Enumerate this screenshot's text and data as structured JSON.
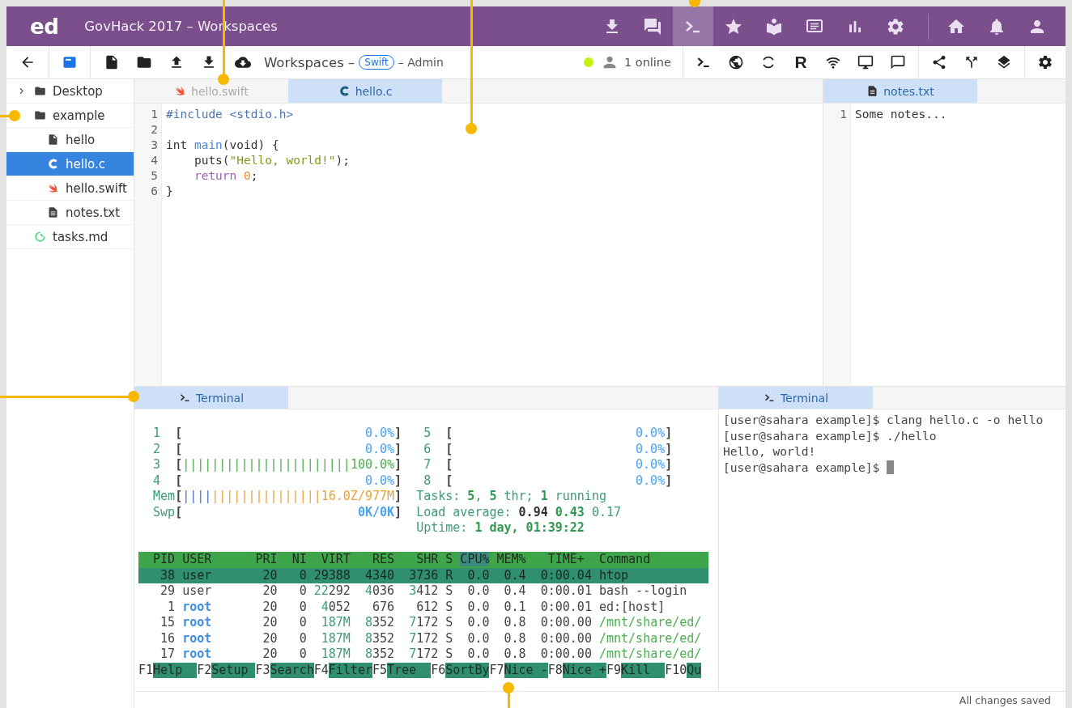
{
  "app_bar": {
    "logo": "ed",
    "title": "GovHack 2017 – Workspaces",
    "buttons": [
      {
        "kind": "download",
        "selected": false
      },
      {
        "kind": "chat",
        "selected": false
      },
      {
        "kind": "terminal",
        "selected": true
      },
      {
        "kind": "star",
        "selected": false
      },
      {
        "kind": "reader",
        "selected": false
      },
      {
        "kind": "slides",
        "selected": false
      },
      {
        "kind": "chart",
        "selected": false
      },
      {
        "kind": "settings",
        "selected": false
      }
    ],
    "user_buttons": [
      {
        "kind": "home",
        "selected": false
      },
      {
        "kind": "notifications",
        "selected": false
      },
      {
        "kind": "account",
        "selected": false
      }
    ]
  },
  "toolbar": {
    "title": "Workspaces –",
    "badge": "Swift",
    "role": "– Admin",
    "presence": "1 online",
    "r_button": "R"
  },
  "file_tree": [
    {
      "name": "Desktop",
      "kind": "folder",
      "expanded": false,
      "selected": false
    },
    {
      "name": "example",
      "kind": "folder",
      "expanded": true,
      "selected": false,
      "children": [
        {
          "name": "hello",
          "kind": "file",
          "selected": false
        },
        {
          "name": "hello.c",
          "kind": "c",
          "selected": true
        },
        {
          "name": "hello.swift",
          "kind": "swift",
          "selected": false
        },
        {
          "name": "notes.txt",
          "kind": "text",
          "selected": false
        }
      ]
    },
    {
      "name": "tasks.md",
      "kind": "markdown",
      "selected": false
    }
  ],
  "editor": {
    "tabs": [
      {
        "label": "hello.swift",
        "kind": "swift",
        "selected": false
      },
      {
        "label": "hello.c",
        "kind": "c",
        "selected": true
      }
    ],
    "lines": [
      {
        "number": "1",
        "tokens": [
          {
            "text": "#include <stdio.h>",
            "kind": "preprocessor"
          }
        ]
      },
      {
        "number": "2"
      },
      {
        "number": "3",
        "tokens": [
          {
            "text": "int ",
            "kind": "plain"
          },
          {
            "text": "main",
            "kind": "function"
          },
          {
            "text": "(void) {",
            "kind": "plain"
          }
        ]
      },
      {
        "number": "4",
        "tokens": [
          {
            "text": "    puts(",
            "kind": "plain"
          },
          {
            "text": "\"Hello, world!\"",
            "kind": "string"
          },
          {
            "text": ");",
            "kind": "plain"
          }
        ]
      },
      {
        "number": "5",
        "tokens": [
          {
            "text": "    return",
            "kind": "keyword"
          },
          {
            "text": " 0",
            "kind": "number"
          },
          {
            "text": ";",
            "kind": "plain"
          }
        ]
      },
      {
        "number": "6",
        "tokens": [
          {
            "text": "}",
            "kind": "plain"
          }
        ]
      }
    ]
  },
  "notes": {
    "tabs": [
      {
        "label": "notes.txt",
        "kind": "text",
        "selected": true
      }
    ],
    "lines": [
      {
        "number": "1",
        "text": "Some notes..."
      }
    ]
  },
  "htop": {
    "tab": {
      "label": "Terminal",
      "selected": true
    },
    "meters_left": [
      {
        "label": "1",
        "open": "[",
        "reading": {
          "text": "0.0%",
          "kind": "blue"
        },
        "close": "]"
      },
      {
        "label": "2",
        "open": "[",
        "reading": {
          "text": "0.0%",
          "kind": "blue"
        },
        "close": "]"
      },
      {
        "label": "3",
        "open": "[",
        "bars": [
          {
            "text": "|||||||||||||||||||||||",
            "kind": "green"
          }
        ],
        "reading": {
          "text": "100.0%",
          "kind": "green"
        },
        "close": "]"
      },
      {
        "label": "4",
        "open": "[",
        "reading": {
          "text": "0.0%",
          "kind": "blue"
        },
        "close": "]"
      },
      {
        "label": "Mem",
        "open": "[",
        "bars": [
          {
            "text": "||||",
            "kind": "blue"
          },
          {
            "text": "|||||||||||||||",
            "kind": "orange"
          }
        ],
        "reading": {
          "text": "16.0Z/977M",
          "kind": "orange"
        },
        "close": "]"
      },
      {
        "label": "Swp",
        "open": "[",
        "reading": {
          "text": "0K/0K",
          "kind": "blue_bold"
        },
        "close": "]"
      }
    ],
    "meters_right": [
      {
        "label": "5",
        "open": "[",
        "reading": {
          "text": "0.0%",
          "kind": "blue"
        },
        "close": "]"
      },
      {
        "label": "6",
        "open": "[",
        "reading": {
          "text": "0.0%",
          "kind": "blue"
        },
        "close": "]"
      },
      {
        "label": "7",
        "open": "[",
        "reading": {
          "text": "0.0%",
          "kind": "blue"
        },
        "close": "]"
      },
      {
        "label": "8",
        "open": "[",
        "reading": {
          "text": "0.0%",
          "kind": "blue"
        },
        "close": "]"
      }
    ],
    "summary": [
      [
        {
          "text": "Tasks: ",
          "kind": "info"
        },
        {
          "text": "5",
          "kind": "info_bold"
        },
        {
          "text": ", ",
          "kind": "info"
        },
        {
          "text": "5",
          "kind": "info_bold"
        },
        {
          "text": " thr; ",
          "kind": "info"
        },
        {
          "text": "1",
          "kind": "info_bold"
        },
        {
          "text": " running",
          "kind": "info"
        }
      ],
      [
        {
          "text": "Load average: ",
          "kind": "info"
        },
        {
          "text": "0.94 ",
          "kind": "dark_bold"
        },
        {
          "text": "0.43",
          "kind": "info_bold"
        },
        {
          "text": " 0.17",
          "kind": "info"
        }
      ],
      [
        {
          "text": "Uptime: ",
          "kind": "info"
        },
        {
          "text": "1 day, 01:39:22",
          "kind": "info_bold"
        }
      ]
    ],
    "header": [
      {
        "text": "  PID USER      PRI  NI  VIRT   RES   SHR S ",
        "kind": "header"
      },
      {
        "text": "CPU%",
        "kind": "header_sorted"
      },
      {
        "text": " MEM%   TIME+  Command",
        "kind": "header"
      }
    ],
    "processes": [
      {
        "selected": true,
        "segments": [
          {
            "text": "   38 user       20   0 29388  4340  3736 R  0.0  0.4  0:00.04 htop",
            "kind": "plain"
          }
        ]
      },
      {
        "selected": false,
        "segments": [
          {
            "text": "   29 user       20   0 ",
            "kind": "plain"
          },
          {
            "text": "22",
            "kind": "big"
          },
          {
            "text": "292  ",
            "kind": "plain"
          },
          {
            "text": "4",
            "kind": "big"
          },
          {
            "text": "036  ",
            "kind": "plain"
          },
          {
            "text": "3",
            "kind": "big"
          },
          {
            "text": "412 S  0.0  0.4  0:00.01 bash --login",
            "kind": "plain"
          }
        ]
      },
      {
        "selected": false,
        "segments": [
          {
            "text": "    1 ",
            "kind": "plain"
          },
          {
            "text": "root",
            "kind": "root"
          },
          {
            "text": "       20   0  ",
            "kind": "plain"
          },
          {
            "text": "4",
            "kind": "big"
          },
          {
            "text": "052   676   612 S  0.0  0.1  0:00.01 ed:[host]",
            "kind": "plain"
          }
        ]
      },
      {
        "selected": false,
        "segments": [
          {
            "text": "   15 ",
            "kind": "plain"
          },
          {
            "text": "root",
            "kind": "root"
          },
          {
            "text": "       20   0  ",
            "kind": "plain"
          },
          {
            "text": "187M  ",
            "kind": "big"
          },
          {
            "text": "8",
            "kind": "big"
          },
          {
            "text": "352  ",
            "kind": "plain"
          },
          {
            "text": "7",
            "kind": "big"
          },
          {
            "text": "172 S  0.0  0.8  0:00.00 ",
            "kind": "plain"
          },
          {
            "text": "/mnt/share/ed/",
            "kind": "path"
          }
        ]
      },
      {
        "selected": false,
        "segments": [
          {
            "text": "   16 ",
            "kind": "plain"
          },
          {
            "text": "root",
            "kind": "root"
          },
          {
            "text": "       20   0  ",
            "kind": "plain"
          },
          {
            "text": "187M  ",
            "kind": "big"
          },
          {
            "text": "8",
            "kind": "big"
          },
          {
            "text": "352  ",
            "kind": "plain"
          },
          {
            "text": "7",
            "kind": "big"
          },
          {
            "text": "172 S  0.0  0.8  0:00.00 ",
            "kind": "plain"
          },
          {
            "text": "/mnt/share/ed/",
            "kind": "path"
          }
        ]
      },
      {
        "selected": false,
        "segments": [
          {
            "text": "   17 ",
            "kind": "plain"
          },
          {
            "text": "root",
            "kind": "root"
          },
          {
            "text": "       20   0  ",
            "kind": "plain"
          },
          {
            "text": "187M  ",
            "kind": "big"
          },
          {
            "text": "8",
            "kind": "big"
          },
          {
            "text": "352  ",
            "kind": "plain"
          },
          {
            "text": "7",
            "kind": "big"
          },
          {
            "text": "172 S  0.0  0.8  0:00.00 ",
            "kind": "plain"
          },
          {
            "text": "/mnt/share/ed/",
            "kind": "path"
          }
        ]
      }
    ],
    "function_keys": [
      {
        "key": "F1",
        "label": "Help"
      },
      {
        "key": "F2",
        "label": "Setup"
      },
      {
        "key": "F3",
        "label": "Search"
      },
      {
        "key": "F4",
        "label": "Filter"
      },
      {
        "key": "F5",
        "label": "Tree"
      },
      {
        "key": "F6",
        "label": "SortBy"
      },
      {
        "key": "F7",
        "label": "Nice -"
      },
      {
        "key": "F8",
        "label": "Nice +"
      },
      {
        "key": "F9",
        "label": "Kill"
      },
      {
        "key": "F10",
        "label": "Qu"
      }
    ]
  },
  "shell": {
    "tab": {
      "label": "Terminal",
      "selected": true
    },
    "lines": [
      "[user@sahara example]$ clang hello.c -o hello",
      "[user@sahara example]$ ./hello",
      "Hello, world!",
      "[user@sahara example]$"
    ],
    "cursor": true
  },
  "status_bar": {
    "text": "All changes saved"
  }
}
